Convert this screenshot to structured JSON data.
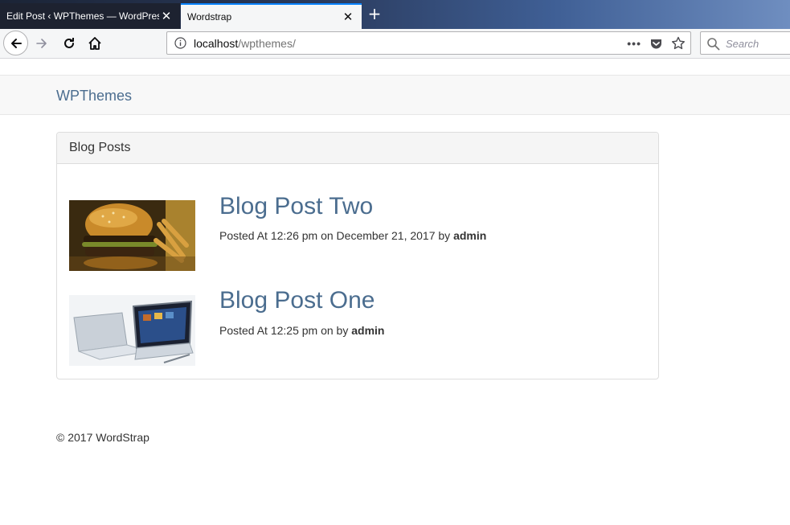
{
  "browser": {
    "tabs": [
      {
        "title": "Edit Post ‹ WPThemes — WordPress"
      },
      {
        "title": "Wordstrap"
      }
    ],
    "new_tab_symbol": "+",
    "url_host": "localhost",
    "url_path": "/wpthemes/",
    "url_more": "•••",
    "search_placeholder": "Search"
  },
  "site": {
    "brand": "WPThemes",
    "panel_title": "Blog Posts",
    "posts": [
      {
        "title": "Blog Post Two",
        "meta_prefix": "Posted At 12:26 pm on December 21, 2017 by ",
        "author": "admin",
        "thumbnail": "burger-image"
      },
      {
        "title": "Blog Post One",
        "meta_prefix": "Posted At 12:25 pm on by ",
        "author": "admin",
        "thumbnail": "laptop-image"
      }
    ],
    "footer": "© 2017 WordStrap"
  },
  "colors": {
    "link": "#4b6d8f",
    "tab_accent": "#0a84ff"
  }
}
